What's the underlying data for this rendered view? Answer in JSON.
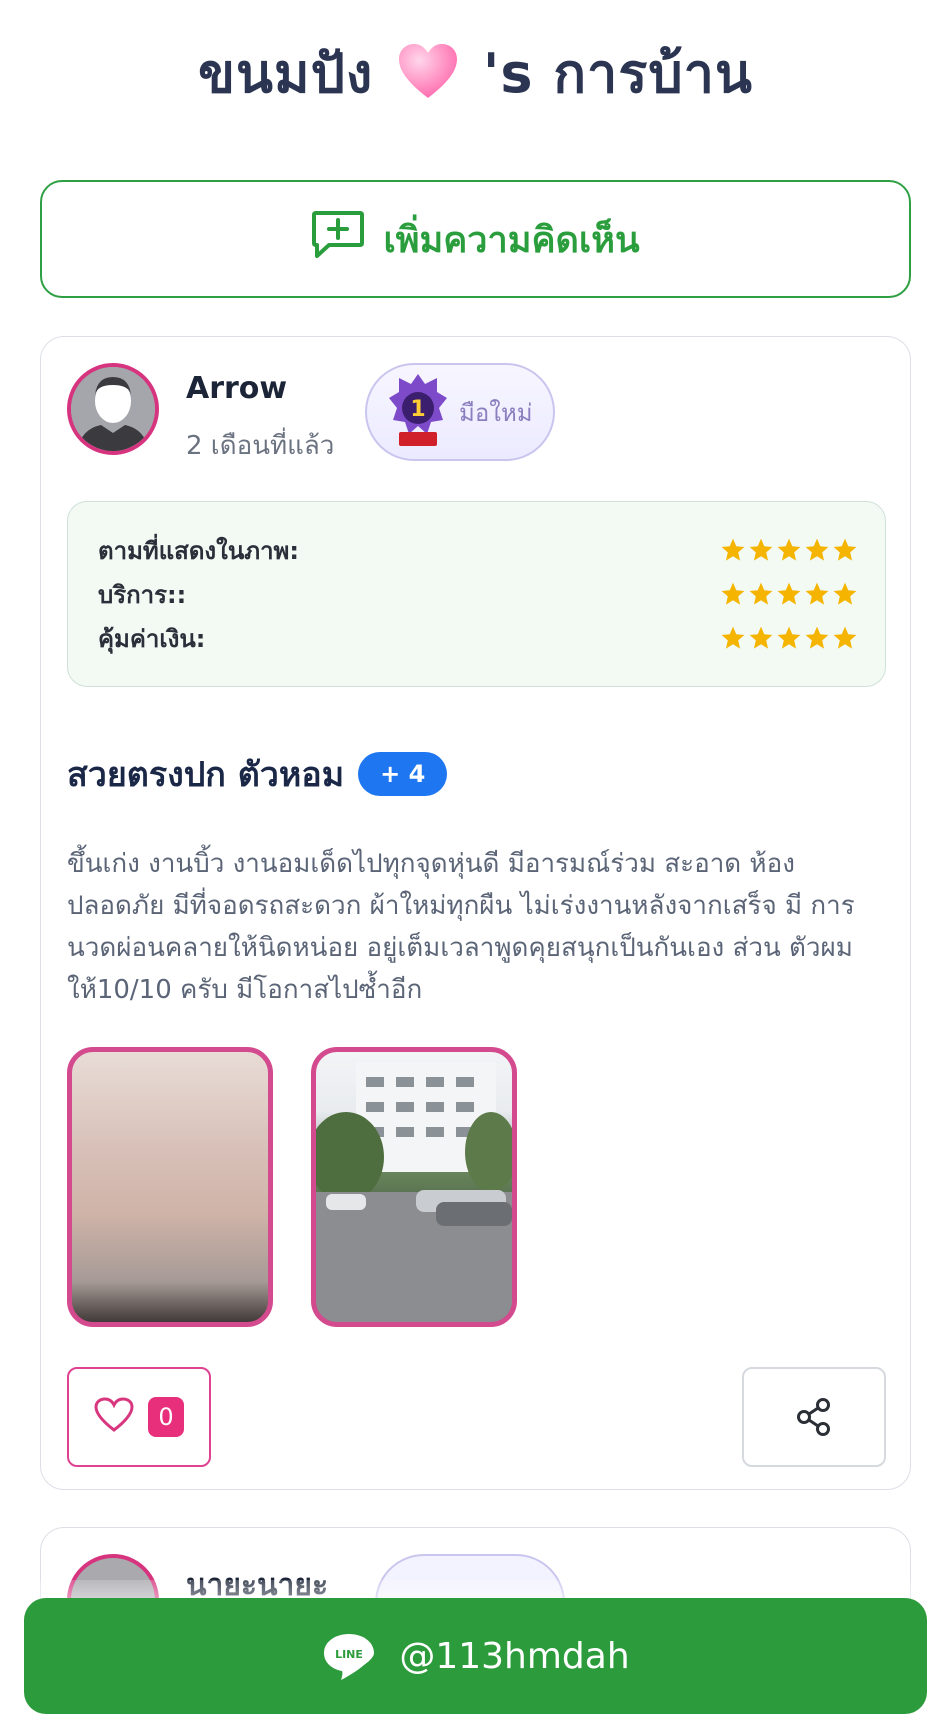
{
  "header": {
    "title_prefix": "ขนมปัง",
    "heart_icon": "pink-heart-icon",
    "title_suffix": "'s การบ้าน"
  },
  "actions": {
    "add_comment_label": "เพิ่มความคิดเห็น",
    "add_comment_icon": "comment-plus-icon"
  },
  "review": {
    "author": "Arrow",
    "time_ago": "2 เดือนที่แล้ว",
    "rank_badge": {
      "icon": "rank-1-badge-icon",
      "label": "มือใหม่"
    },
    "ratings": [
      {
        "label": "ตามที่แสดงในภาพ:",
        "stars": 5,
        "max": 5
      },
      {
        "label": "บริการ::",
        "stars": 5,
        "max": 5
      },
      {
        "label": "คุ้มค่าเงิน:",
        "stars": 5,
        "max": 5
      }
    ],
    "title": "สวยตรงปก ตัวหอม",
    "tag_more": "+ 4",
    "body": "ขึ้นเก่ง งานบิ้ว งานอมเด็ดไปทุกจุดหุ่นดี มีอารมณ์ร่วม สะอาด ห้อง ปลอดภัย มีที่จอดรถสะดวก ผ้าใหม่ทุกผืน ไม่เร่งงานหลังจากเสร็จ มี การนวดผ่อนคลายให้นิดหน่อย อยู่เต็มเวลาพูดคุยสนุกเป็นกันเอง ส่วน ตัวผมให้10/10 ครับ มีโอกาสไปซ้ำอีก",
    "photos": [
      "photo-1",
      "photo-2"
    ],
    "likes": "0",
    "like_icon": "heart-outline-icon",
    "share_icon": "share-icon"
  },
  "next_review": {
    "author_partial": "นายะนายะ"
  },
  "footer": {
    "line_label": "LINE",
    "line_id": "@113hmdah"
  },
  "colors": {
    "green": "#2c9b3b",
    "pink": "#e04292",
    "blue": "#1e76f0",
    "star": "#f5b400"
  }
}
